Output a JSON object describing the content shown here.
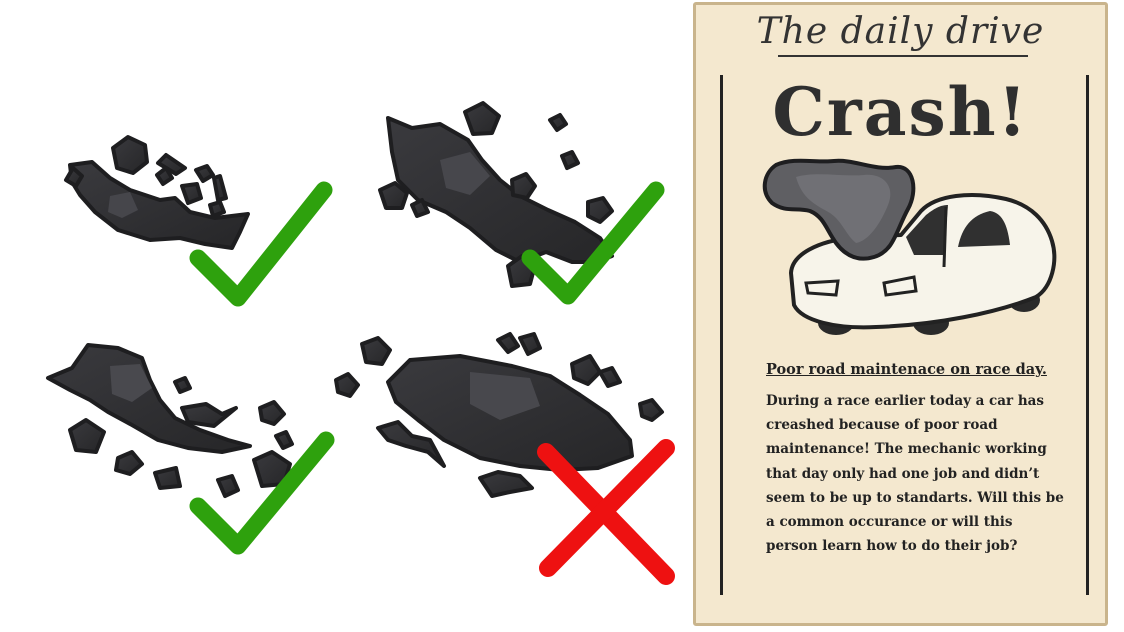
{
  "game": {
    "debris_variants": [
      {
        "id": "debris-1",
        "status": "accepted",
        "status_icon": "checkmark-icon"
      },
      {
        "id": "debris-2",
        "status": "accepted",
        "status_icon": "checkmark-icon"
      },
      {
        "id": "debris-3",
        "status": "accepted",
        "status_icon": "checkmark-icon"
      },
      {
        "id": "debris-4",
        "status": "rejected",
        "status_icon": "cross-icon"
      }
    ],
    "colors": {
      "debris_dark": "#2a2a2d",
      "debris_outline": "#1e1e20",
      "debris_highlight": "#4d4d52",
      "check_green": "#2ea10d",
      "cross_red": "#ee1111"
    }
  },
  "newspaper": {
    "masthead": "The daily drive",
    "headline": "Crash!",
    "image_icon": "crashed-car-icon",
    "subheadline": "Poor road maintenace on race day.",
    "body": "During a race earlier today a car has creashed because of poor road maintenance! The mechanic working that day only had one job and didn’t seem to be up to standarts. Will this be a common occurance or will this person learn how to do their job?",
    "colors": {
      "paper": "#f4e8cf",
      "border": "#c9b48c",
      "ink": "#2f2f2f"
    }
  }
}
